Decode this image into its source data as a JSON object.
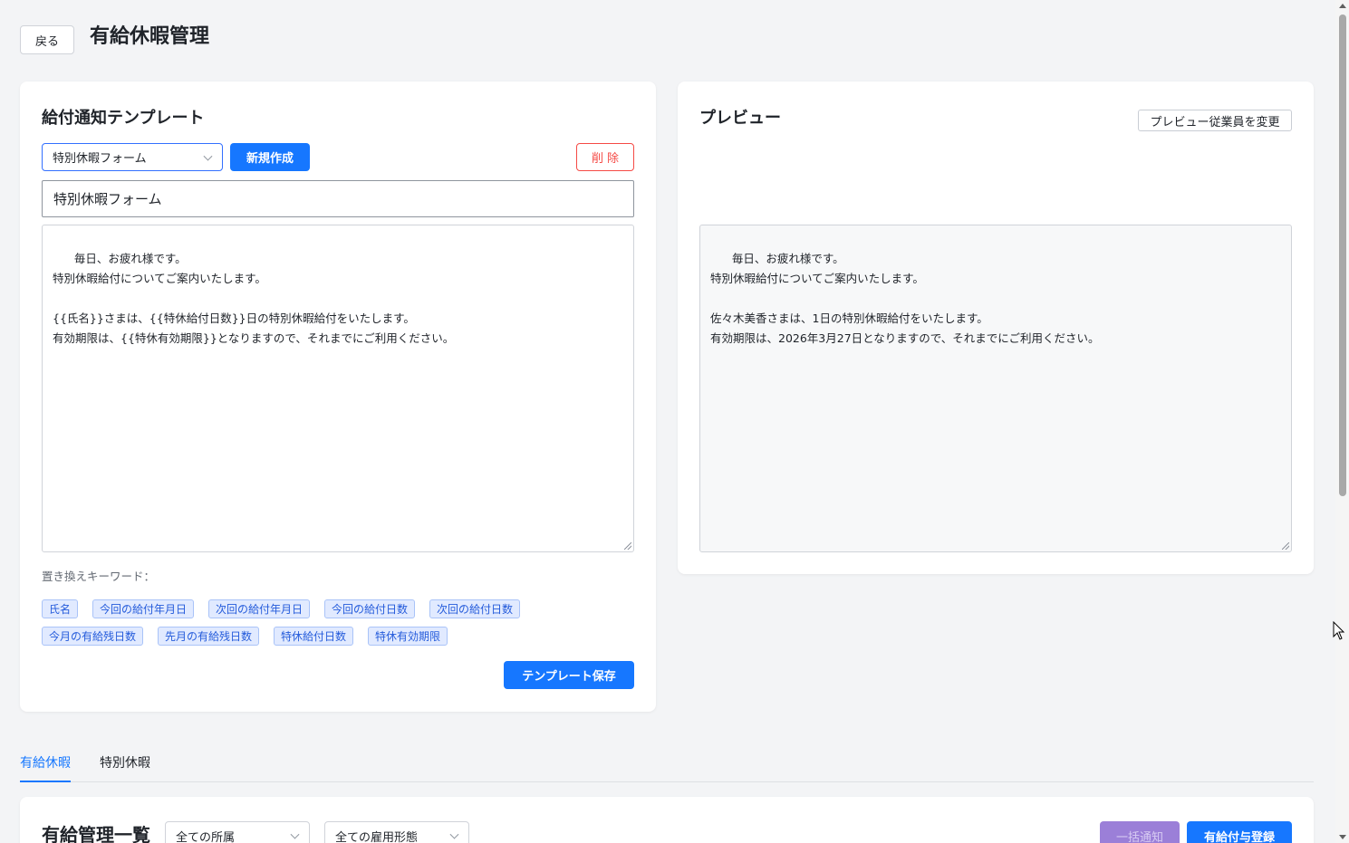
{
  "header": {
    "back_label": "戻る",
    "title": "有給休暇管理"
  },
  "template": {
    "title": "給付通知テンプレート",
    "selected_template": "特別休暇フォーム",
    "new_label": "新規作成",
    "delete_label": "削除",
    "name_value": "特別休暇フォーム",
    "body": "毎日、お疲れ様です。\n特別休暇給付についてご案内いたします。\n\n{{氏名}}さまは、{{特休給付日数}}日の特別休暇給付をいたします。\n有効期限は、{{特休有効期限}}となりますので、それまでにご利用ください。",
    "keywords_label": "置き換えキーワード：",
    "keywords": [
      "氏名",
      "今回の給付年月日",
      "次回の給付年月日",
      "今回の給付日数",
      "次回の給付日数",
      "今月の有給残日数",
      "先月の有給残日数",
      "特休給付日数",
      "特休有効期限"
    ],
    "save_label": "テンプレート保存"
  },
  "preview": {
    "title": "プレビュー",
    "change_employee_label": "プレビュー従業員を変更",
    "body": "毎日、お疲れ様です。\n特別休暇給付についてご案内いたします。\n\n佐々木美香さまは、1日の特別休暇給付をいたします。\n有効期限は、2026年3月27日となりますので、それまでにご利用ください。"
  },
  "tabs": [
    {
      "label": "有給休暇",
      "active": true
    },
    {
      "label": "特別休暇",
      "active": false
    }
  ],
  "list": {
    "title": "有給管理一覧",
    "department_filter": "全ての所属",
    "employment_filter": "全ての雇用形態",
    "bulk_notify_label": "一括通知",
    "register_label": "有給付与登録"
  },
  "colors": {
    "primary": "#1677ff",
    "danger": "#f54a45",
    "disabled_purple": "#9b7fd8",
    "tag_bg": "#e1eaff"
  }
}
